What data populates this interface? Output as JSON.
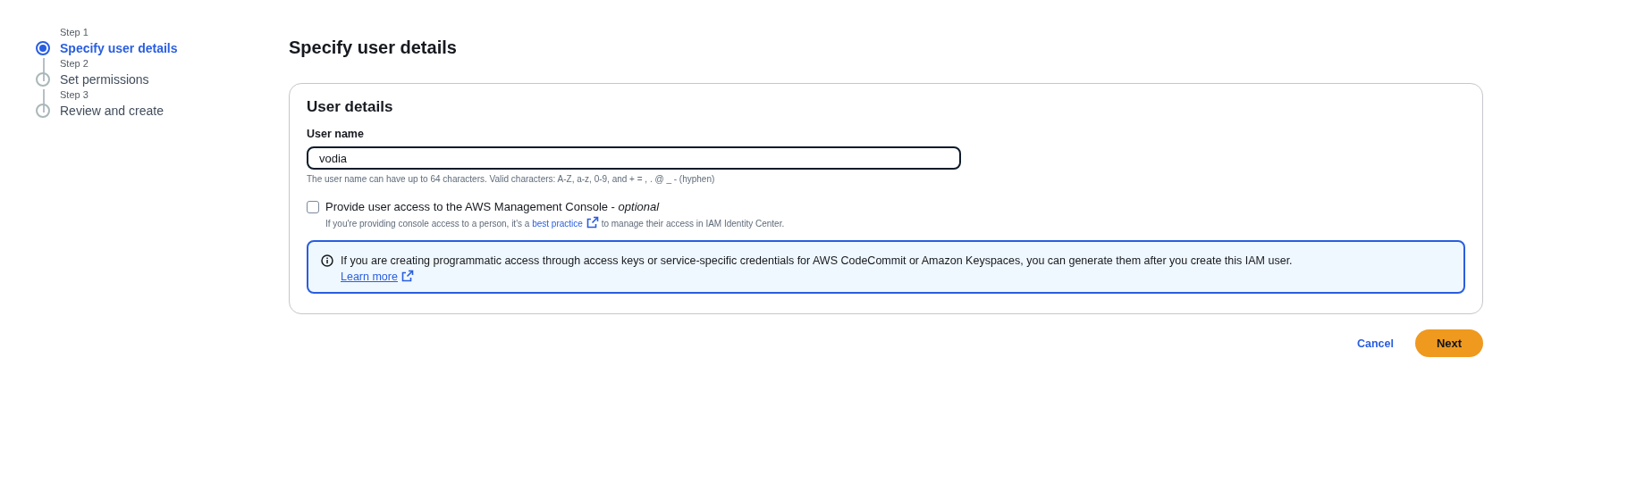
{
  "steps": [
    {
      "step": "Step 1",
      "title": "Specify user details",
      "selected": true
    },
    {
      "step": "Step 2",
      "title": "Set permissions",
      "selected": false
    },
    {
      "step": "Step 3",
      "title": "Review and create",
      "selected": false
    }
  ],
  "page_title": "Specify user details",
  "card": {
    "title": "User details",
    "user_name": {
      "label": "User name",
      "value": "vodia",
      "hint": "The user name can have up to 64 characters. Valid characters: A-Z, a-z, 0-9, and + = , . @ _ - (hyphen)"
    },
    "console_access": {
      "label": "Provide user access to the AWS Management Console - *optional*",
      "checked": false,
      "description_before": "If you're providing console access to a person, it's a",
      "link": "best practice",
      "description_after": "to manage their access in IAM Identity Center."
    },
    "info": {
      "text": "If you are creating programmatic access through access keys or service-specific credentials for AWS CodeCommit or Amazon Keyspaces, you can generate them after you create this IAM user.",
      "link": "Learn more"
    }
  },
  "actions": [
    {
      "label": "Cancel",
      "kind": "link"
    },
    {
      "label": "Next",
      "kind": "primary"
    }
  ]
}
